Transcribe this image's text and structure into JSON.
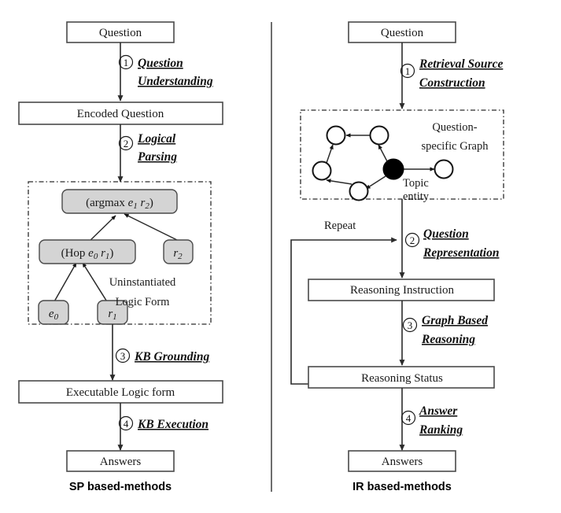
{
  "figure": {
    "panels": [
      {
        "id": "sp",
        "caption": "SP based-methods",
        "nodes": [
          {
            "name": "question",
            "label": "Question"
          },
          {
            "name": "encoded-question",
            "label": "Encoded Question"
          },
          {
            "name": "executable-logic-form",
            "label": "Executable Logic form"
          },
          {
            "name": "answers",
            "label": "Answers"
          }
        ],
        "steps": [
          {
            "num": "1",
            "line1": "Question",
            "line2": "Understanding"
          },
          {
            "num": "2",
            "line1": "Logical",
            "line2": "Parsing"
          },
          {
            "num": "3",
            "line1": "KB Grounding",
            "line2": ""
          },
          {
            "num": "4",
            "line1": "KB Execution",
            "line2": ""
          }
        ],
        "logic_form": {
          "annotation_line1": "Uninstantiated",
          "annotation_line2": "Logic Form",
          "root": "(argmax e1 r2)",
          "root_parts": [
            "(argmax ",
            "e",
            "1",
            " ",
            "r",
            "2",
            ")"
          ],
          "children": [
            "(Hop e0 r1)",
            "r2"
          ],
          "leaves": [
            "e0",
            "r1"
          ]
        }
      },
      {
        "id": "ir",
        "caption": "IR based-methods",
        "nodes": [
          {
            "name": "question",
            "label": "Question"
          },
          {
            "name": "reasoning-instruction",
            "label": "Reasoning Instruction"
          },
          {
            "name": "reasoning-status",
            "label": "Reasoning Status"
          },
          {
            "name": "answers",
            "label": "Answers"
          }
        ],
        "steps": [
          {
            "num": "1",
            "line1": "Retrieval Source",
            "line2": "Construction"
          },
          {
            "num": "2",
            "line1": "Question",
            "line2": "Representation"
          },
          {
            "num": "3",
            "line1": "Graph Based",
            "line2": "Reasoning"
          },
          {
            "num": "4",
            "line1": "Answer",
            "line2": "Ranking"
          }
        ],
        "graph": {
          "annotation_line1": "Question-",
          "annotation_line2": "specific  Graph",
          "topic_label_line1": "Topic",
          "topic_label_line2": "entity",
          "node_count": 6,
          "topic_node_index": 4
        },
        "loop_label": "Repeat"
      }
    ],
    "colors": {
      "box_fill": "#ffffff",
      "box_stroke": "#4a4a4a",
      "grey_fill": "#d4d4d4",
      "line": "#2b2b2b",
      "topic_node": "#000000",
      "divider": "#6e6e6e",
      "text": "#1a1a1a"
    }
  }
}
